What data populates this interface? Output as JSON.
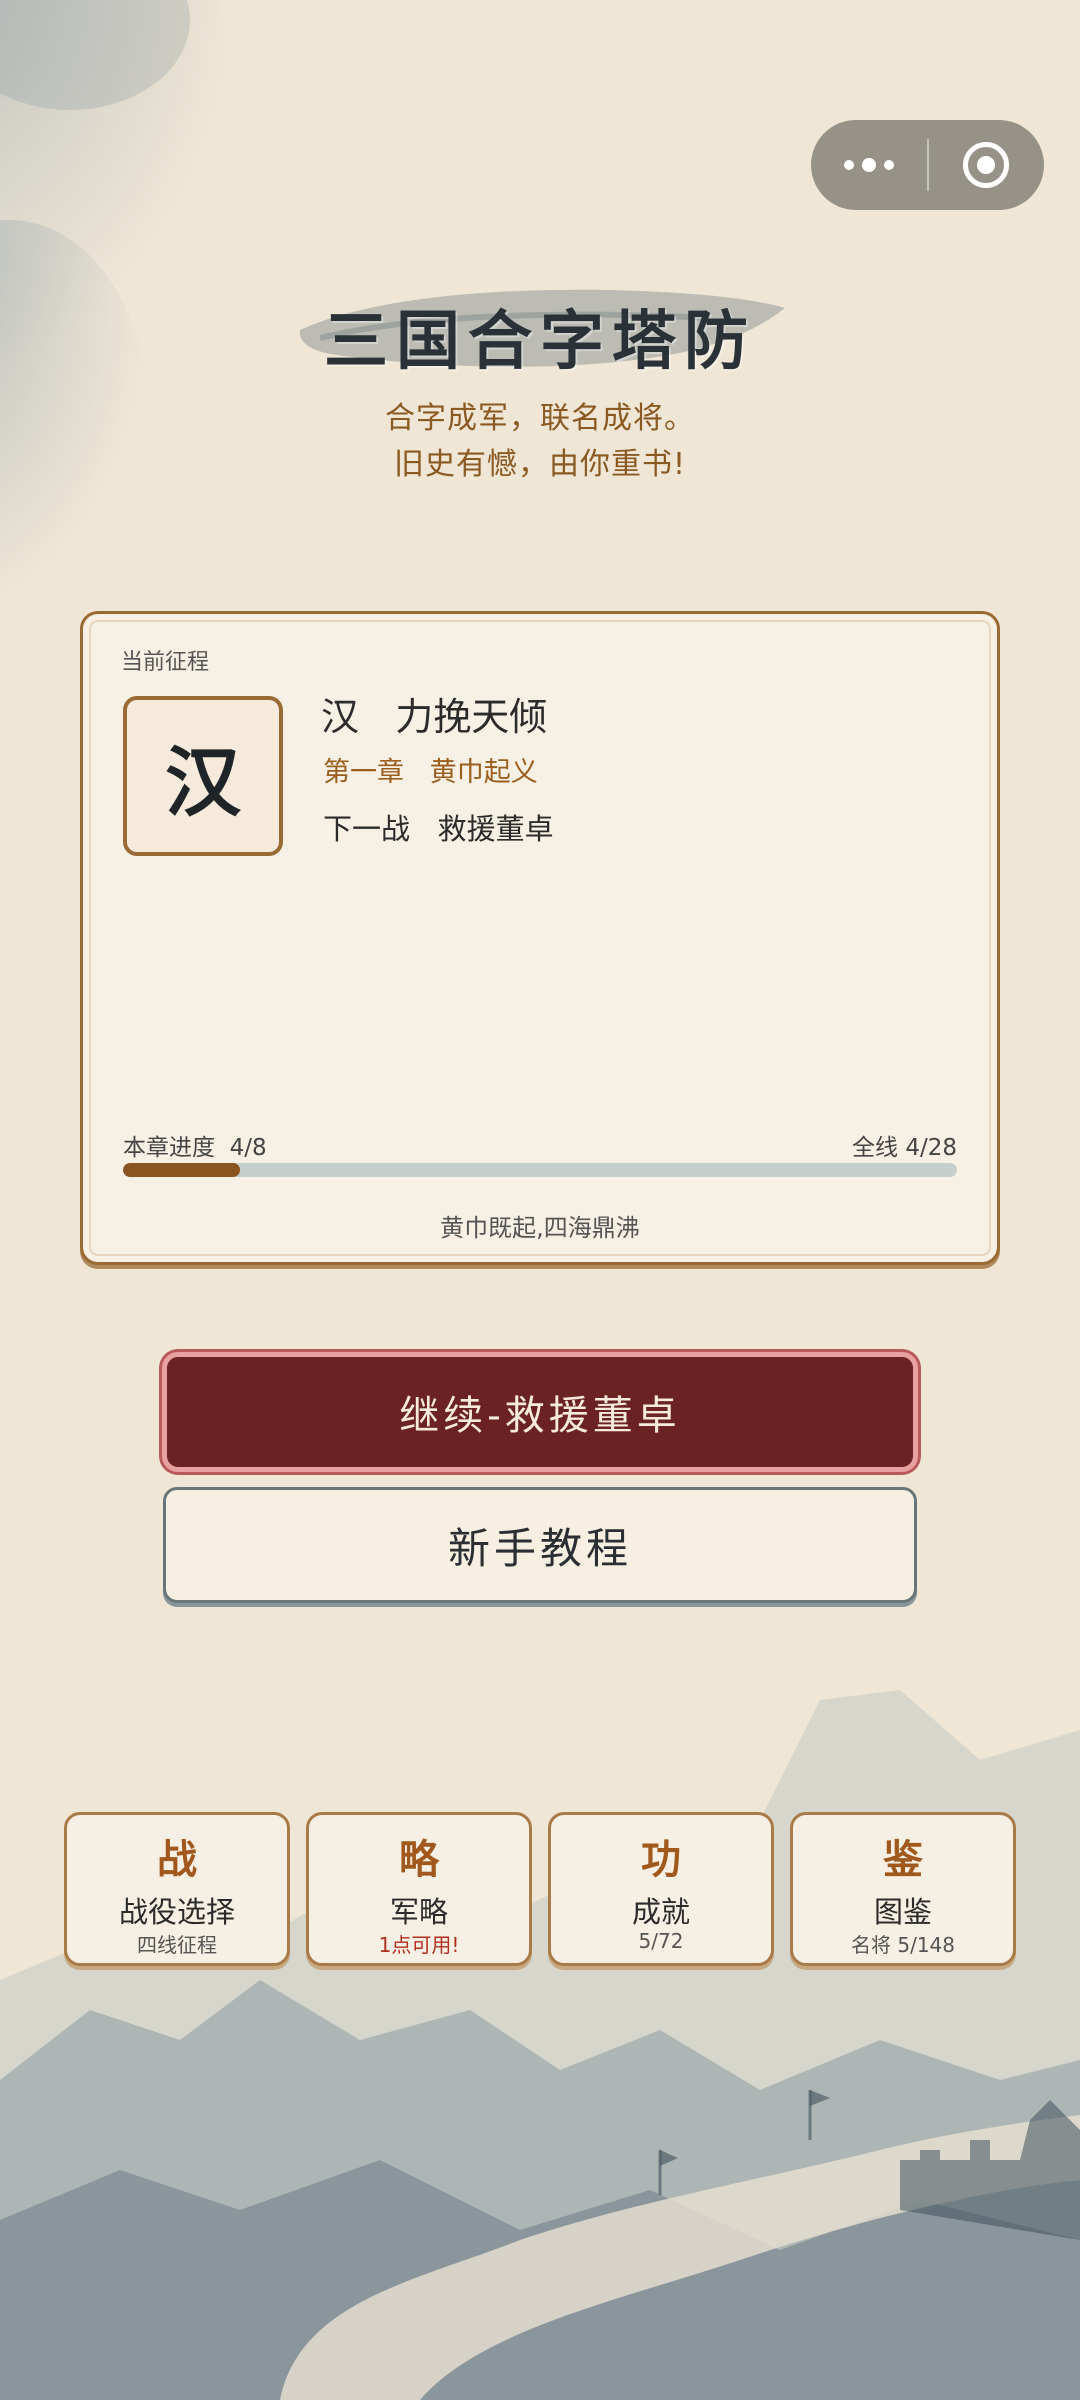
{
  "header": {
    "title": "三国合字塔防",
    "subtitle_line1": "合字成军，联名成将。",
    "subtitle_line2": "旧史有憾，由你重书!"
  },
  "campaign_card": {
    "label": "当前征程",
    "seal_char": "汉",
    "faction_title": "汉   力挽天倾",
    "chapter": "第一章   黄巾起义",
    "next_battle": "下一战   救援董卓",
    "chapter_progress_label": "本章进度  4/8",
    "overall_progress_label": "全线 4/28",
    "chapter_progress_fraction": 0.14,
    "quote": "黄巾既起,四海鼎沸"
  },
  "buttons": {
    "continue": "继续-救援董卓",
    "tutorial": "新手教程"
  },
  "tiles": [
    {
      "glyph": "战",
      "name": "战役选择",
      "sub": "四线征程"
    },
    {
      "glyph": "略",
      "name": "军略",
      "sub": "1点可用!"
    },
    {
      "glyph": "功",
      "name": "成就",
      "sub": "5/72"
    },
    {
      "glyph": "鉴",
      "name": "图鉴",
      "sub": "名将 5/148"
    }
  ],
  "colors": {
    "background": "#efe6d6",
    "accent_brown": "#9a6a34",
    "primary_button": "#6b2222",
    "alert_text": "#b03020",
    "ink": "#2a3238"
  }
}
